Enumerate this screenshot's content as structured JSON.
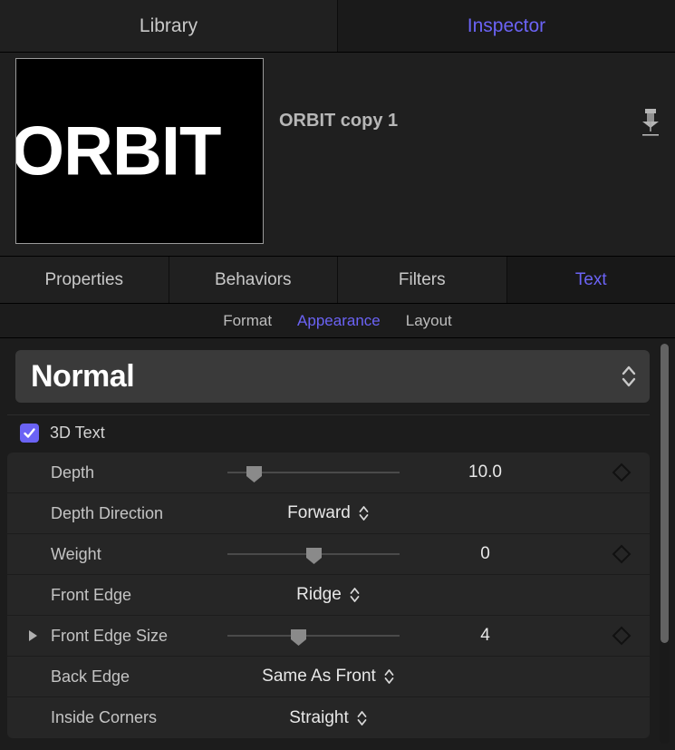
{
  "main_tabs": [
    {
      "label": "Library",
      "active": false
    },
    {
      "label": "Inspector",
      "active": true
    }
  ],
  "header": {
    "title": "ORBIT copy 1",
    "preview_text": "ORBIT",
    "pin_icon": "pin-icon"
  },
  "section_tabs": [
    {
      "label": "Properties",
      "active": false
    },
    {
      "label": "Behaviors",
      "active": false
    },
    {
      "label": "Filters",
      "active": false
    },
    {
      "label": "Text",
      "active": true
    }
  ],
  "sub_tabs": [
    {
      "label": "Format",
      "active": false
    },
    {
      "label": "Appearance",
      "active": true
    },
    {
      "label": "Layout",
      "active": false
    }
  ],
  "blend": {
    "value": "Normal",
    "stepper_icon": "up-down-chevron-icon"
  },
  "three_d_text": {
    "label": "3D Text",
    "checked": true,
    "check_icon": "checkmark-icon"
  },
  "rows": [
    {
      "label": "Depth",
      "type": "slider",
      "value": "10.0",
      "slider_pct": 15,
      "has_keyframe": true,
      "disclosure": false
    },
    {
      "label": "Depth Direction",
      "type": "popup",
      "value": "Forward",
      "has_keyframe": false,
      "disclosure": false
    },
    {
      "label": "Weight",
      "type": "slider",
      "value": "0",
      "slider_pct": 50,
      "has_keyframe": true,
      "disclosure": false
    },
    {
      "label": "Front Edge",
      "type": "popup",
      "value": "Ridge",
      "has_keyframe": false,
      "disclosure": false
    },
    {
      "label": "Front Edge Size",
      "type": "slider",
      "value": "4",
      "slider_pct": 41,
      "has_keyframe": true,
      "disclosure": true
    },
    {
      "label": "Back Edge",
      "type": "popup",
      "value": "Same As Front",
      "has_keyframe": false,
      "disclosure": false
    },
    {
      "label": "Inside Corners",
      "type": "popup",
      "value": "Straight",
      "has_keyframe": false,
      "disclosure": false
    }
  ],
  "colors": {
    "accent": "#6b63f5",
    "panel_bg": "#1c1c1c",
    "row_bg": "#262626"
  }
}
